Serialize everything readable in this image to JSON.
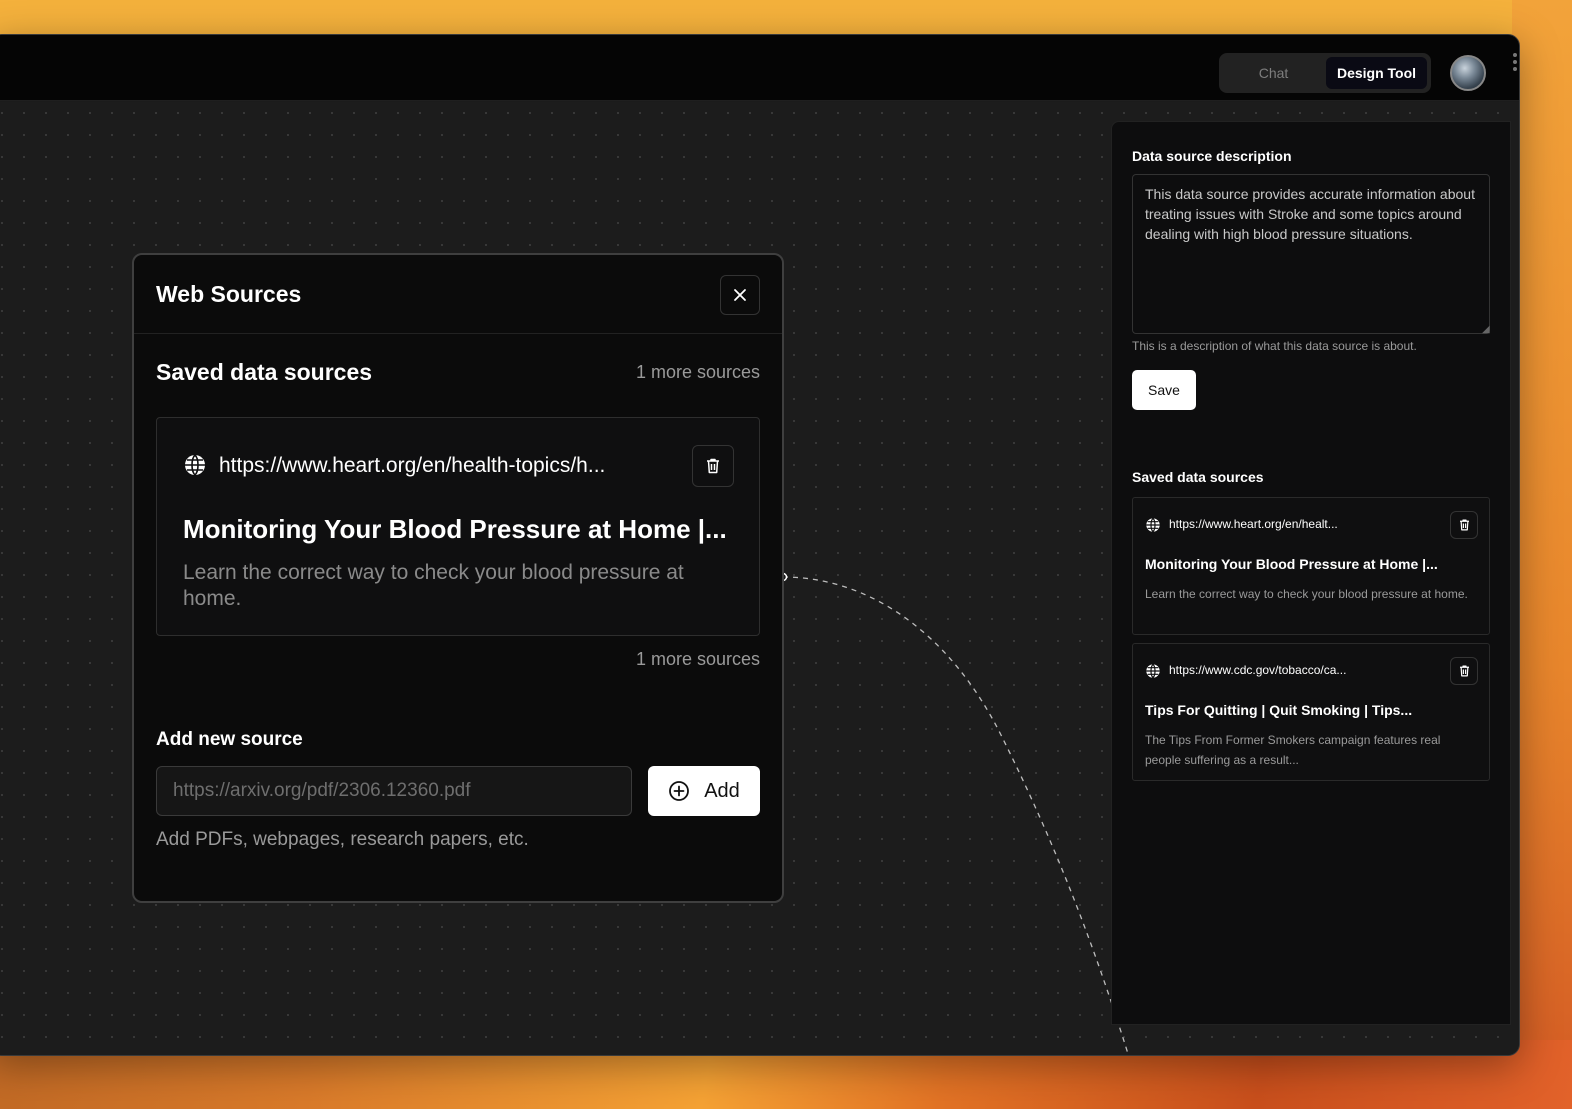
{
  "topbar": {
    "modes": [
      {
        "label": "Chat",
        "active": false
      },
      {
        "label": "Design Tool",
        "active": true
      }
    ]
  },
  "modal": {
    "title": "Web Sources",
    "saved_title": "Saved data sources",
    "more_sources_top": "1 more sources",
    "more_sources_bottom": "1 more sources",
    "card": {
      "url": "https://www.heart.org/en/health-topics/h...",
      "title": "Monitoring Your Blood Pressure at Home |...",
      "description": "Learn the correct way to check your blood pressure at home."
    },
    "add": {
      "label": "Add new source",
      "placeholder": "https://arxiv.org/pdf/2306.12360.pdf",
      "button_label": "Add",
      "hint": "Add PDFs, webpages, research papers, etc."
    }
  },
  "side_panel": {
    "description_label": "Data source description",
    "description_value": "This data source provides accurate information about treating issues with Stroke and some topics around dealing with high blood pressure situations.",
    "description_hint": "This is a description of what this data source is about.",
    "save_label": "Save",
    "saved_title": "Saved data sources",
    "sources": [
      {
        "url": "https://www.heart.org/en/healt...",
        "title": "Monitoring Your Blood Pressure at Home |...",
        "description": "Learn the correct way to check your blood pressure at home."
      },
      {
        "url": "https://www.cdc.gov/tobacco/ca...",
        "title": "Tips For Quitting | Quit Smoking | Tips...",
        "description": "The Tips From Former Smokers campaign features real people suffering as a result..."
      }
    ]
  }
}
